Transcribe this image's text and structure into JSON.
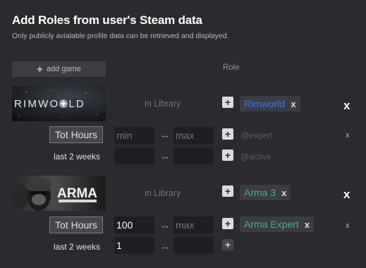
{
  "header": {
    "title": "Add Roles from user's Steam data",
    "subtitle": "Only publicly avialable profile data can be retrieved and displayed."
  },
  "toolbar": {
    "add_game_label": "add game",
    "role_column_label": "Role"
  },
  "games": [
    {
      "name": "RIMWORLD",
      "in_library_label": "in Library",
      "role_tag": "Rimworld",
      "tag_color": "#3d7ddc",
      "remove_label": "x",
      "total_hours": {
        "button_label": "Tot Hours",
        "min_value": "",
        "min_placeholder": "min",
        "max_value": "",
        "max_placeholder": "max",
        "role_placeholder": "@expert",
        "remove_label": "x"
      },
      "last_2_weeks": {
        "label": "last 2 weeks",
        "min_value": "",
        "max_value": "",
        "role_placeholder": "@active"
      }
    },
    {
      "name": "ARMA",
      "in_library_label": "in Library",
      "role_tag": "Arma 3",
      "tag_color": "#43b581",
      "remove_label": "x",
      "total_hours": {
        "button_label": "Tot Hours",
        "min_value": "100",
        "max_value": "",
        "max_placeholder": "max",
        "role_tag": "Arma Expert",
        "remove_label": "x"
      },
      "last_2_weeks": {
        "label": "last 2 weeks",
        "min_value": "1",
        "max_value": ""
      }
    }
  ],
  "symbols": {
    "range_arrow": "↔",
    "plus": "+",
    "close": "x"
  },
  "icons": {
    "add": "plus-icon",
    "range": "range-arrow-icon",
    "remove": "close-icon"
  }
}
